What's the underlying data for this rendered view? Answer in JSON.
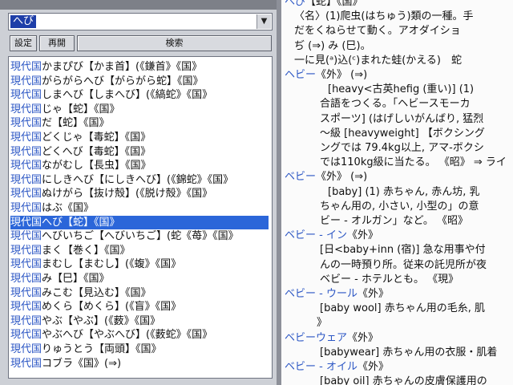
{
  "search": {
    "value": "へび",
    "dropdown_icon": "▼"
  },
  "buttons": {
    "settei": "設定",
    "saikai": "再開",
    "kensaku": "検索"
  },
  "results": [
    {
      "tag": "現代国",
      "text": "かまぴび【かま首】(《鎌首》《国》"
    },
    {
      "tag": "現代国",
      "text": "がらがらへび【がらがら蛇】《国》"
    },
    {
      "tag": "現代国",
      "text": "しまへび【しまへび】(《縞蛇》《国》"
    },
    {
      "tag": "現代国",
      "text": "じゃ【蛇】《国》"
    },
    {
      "tag": "現代国",
      "text": "だ【蛇】《国》"
    },
    {
      "tag": "現代国",
      "text": "どくじゃ【毒蛇】《国》"
    },
    {
      "tag": "現代国",
      "text": "どくへび【毒蛇】《国》"
    },
    {
      "tag": "現代国",
      "text": "ながむし【長虫】《国》"
    },
    {
      "tag": "現代国",
      "text": "にしきへび【にしきへび】(《錦蛇》《国》"
    },
    {
      "tag": "現代国",
      "text": "ぬけがら【抜け殻】(《脱け殻》《国》"
    },
    {
      "tag": "現代国",
      "text": "はぶ《国》"
    },
    {
      "tag": "現代国",
      "text": "へび【蛇】《国》",
      "selected": true
    },
    {
      "tag": "現代国",
      "text": "へびいちご【へびいちご】(蛇《苺》《国》"
    },
    {
      "tag": "現代国",
      "text": "まく【巻く】《国》"
    },
    {
      "tag": "現代国",
      "text": "まむし【まむし】(《蝮》《国》"
    },
    {
      "tag": "現代国",
      "text": "み【巳】《国》"
    },
    {
      "tag": "現代国",
      "text": "みこむ【見込む】《国》"
    },
    {
      "tag": "現代国",
      "text": "めくら【めくら】(《盲》《国》"
    },
    {
      "tag": "現代国",
      "text": "やぶ【やぶ】(《薮》《国》"
    },
    {
      "tag": "現代国",
      "text": "やぶへび【やぶへび】(《薮蛇》《国》"
    },
    {
      "tag": "現代国",
      "text": "りゅうとう【両頭】《国》"
    },
    {
      "tag": "現代国",
      "text": "コブラ《国》(⇒)"
    }
  ],
  "definition_lines": [
    {
      "head": "へび",
      "text": "【蛇】《国》"
    },
    {
      "text": "〈名〉(1)爬虫(はちゅう)類の一種。手"
    },
    {
      "text": "だをくねらせて動く。アオダイショ"
    },
    {
      "text": "ぢ (⇒) み (巳)。"
    },
    {
      "text": "一に見(ᵃ)込(ᶜ)まれた蛙(かえる)　蛇"
    },
    {
      "head": "ヘビー",
      "text": "《外》 (⇒)"
    },
    {
      "text": "[heavy<古英hefig (重い)] (1)"
    },
    {
      "text": "合語をつくる。「ヘビースモーカ"
    },
    {
      "text": "スポーツ] (はげしいがんばり, 猛烈"
    },
    {
      "text": "〜級 [heavyweight] 【ボクシング"
    },
    {
      "text": "ングでは 79.4kg以上, アマ-ボクシ"
    },
    {
      "text": "では110kg級に当たる。 《昭》 ⇒ ライ"
    },
    {
      "head": "ベビー",
      "text": "《外》 (⇒)"
    },
    {
      "text": "[baby] (1) 赤ちゃん, 赤ん坊, 乳"
    },
    {
      "text": "ちゃん用の, 小さい, 小型の」の意"
    },
    {
      "text": "ビー - オルガン」など。 《昭》"
    },
    {
      "head": "ベビー - イン",
      "text": "《外》"
    },
    {
      "text": "[日<baby+inn (宿)] 急な用事や付"
    },
    {
      "text": "んの一時預り所。従来の託児所が夜"
    },
    {
      "text": "ベビー - ホテルとも。 《現》"
    },
    {
      "head": "ベビー - ウール",
      "text": "《外》"
    },
    {
      "text": "[baby wool] 赤ちゃん用の毛糸, 肌"
    },
    {
      "text": "》"
    },
    {
      "head": "ベビーウェア",
      "text": "《外》"
    },
    {
      "text": "[babywear] 赤ちゃん用の衣服・肌着"
    },
    {
      "head": "ベビー - オイル",
      "text": "《外》"
    },
    {
      "text": "[baby oil] 赤ちゃんの皮膚保護用の"
    }
  ]
}
